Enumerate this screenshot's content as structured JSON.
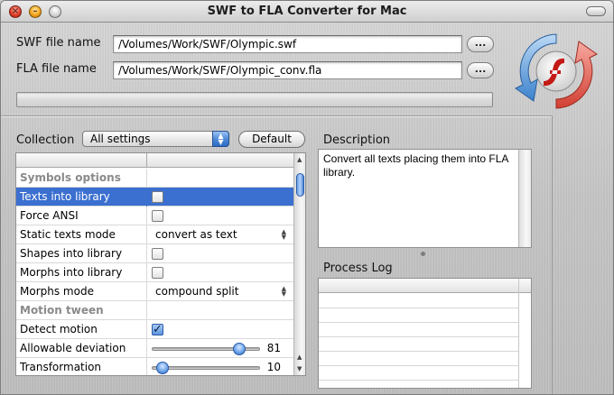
{
  "window": {
    "title": "SWF to FLA Converter for Mac"
  },
  "files": {
    "swf_label": "SWF file name",
    "swf_value": "/Volumes/Work/SWF/Olympic.swf",
    "fla_label": "FLA file name",
    "fla_value": "/Volumes/Work/SWF/Olympic_conv.fla",
    "browse_label": "...",
    "progress": 0
  },
  "collection": {
    "label": "Collection",
    "selected": "All settings",
    "default_button": "Default"
  },
  "settings_rows": [
    {
      "label": "Symbols options",
      "type": "group"
    },
    {
      "label": "Texts into library",
      "type": "checkbox",
      "checked": false,
      "selected": true
    },
    {
      "label": "Force ANSI",
      "type": "checkbox",
      "checked": false
    },
    {
      "label": "Static texts mode",
      "type": "select",
      "value": "convert as text"
    },
    {
      "label": "Shapes into library",
      "type": "checkbox",
      "checked": false
    },
    {
      "label": "Morphs into library",
      "type": "checkbox",
      "checked": false
    },
    {
      "label": "Morphs mode",
      "type": "select",
      "value": "compound split"
    },
    {
      "label": "Motion tween",
      "type": "group"
    },
    {
      "label": "Detect motion",
      "type": "checkbox",
      "checked": true
    },
    {
      "label": "Allowable deviation",
      "type": "slider",
      "value": "81",
      "fraction": 0.81
    },
    {
      "label": "Transformation",
      "type": "slider",
      "value": "10",
      "fraction": 0.1
    }
  ],
  "description": {
    "title": "Description",
    "text": "Convert all texts placing them into FLA library."
  },
  "log": {
    "title": "Process Log"
  },
  "icons": {
    "checkmark": "✓",
    "close": "×",
    "minimize": "–",
    "up_down": "▲▼"
  }
}
